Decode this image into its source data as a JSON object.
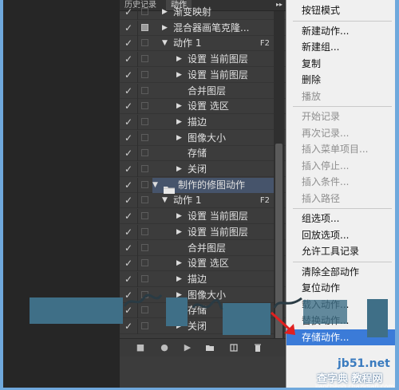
{
  "panel": {
    "tabs": [
      "历史记录",
      "动作"
    ],
    "menu_button_icon": "double-arrow-menu-icon",
    "rows": [
      {
        "check": true,
        "dialog": false,
        "indent": 0,
        "expand": "collapsed",
        "folder": false,
        "label": "渐变映射",
        "fkey": ""
      },
      {
        "check": true,
        "dialog": true,
        "indent": 0,
        "expand": "collapsed",
        "folder": false,
        "label": "混合器画笔克隆...",
        "fkey": ""
      },
      {
        "check": true,
        "dialog": false,
        "indent": 0,
        "expand": "expanded",
        "folder": false,
        "label": "动作 1",
        "fkey": "F2"
      },
      {
        "check": true,
        "dialog": false,
        "indent": 1,
        "expand": "collapsed",
        "folder": false,
        "label": "设置 当前图层",
        "fkey": ""
      },
      {
        "check": true,
        "dialog": false,
        "indent": 1,
        "expand": "collapsed",
        "folder": false,
        "label": "设置 当前图层",
        "fkey": ""
      },
      {
        "check": true,
        "dialog": false,
        "indent": 1,
        "expand": "none",
        "folder": false,
        "label": "合并图层",
        "fkey": ""
      },
      {
        "check": true,
        "dialog": false,
        "indent": 1,
        "expand": "collapsed",
        "folder": false,
        "label": "设置 选区",
        "fkey": ""
      },
      {
        "check": true,
        "dialog": false,
        "indent": 1,
        "expand": "collapsed",
        "folder": false,
        "label": "描边",
        "fkey": ""
      },
      {
        "check": true,
        "dialog": false,
        "indent": 1,
        "expand": "collapsed",
        "folder": false,
        "label": "图像大小",
        "fkey": ""
      },
      {
        "check": true,
        "dialog": false,
        "indent": 1,
        "expand": "none",
        "folder": false,
        "label": "存储",
        "fkey": ""
      },
      {
        "check": true,
        "dialog": false,
        "indent": 1,
        "expand": "collapsed",
        "folder": false,
        "label": "关闭",
        "fkey": ""
      },
      {
        "check": true,
        "dialog": false,
        "indent": -1,
        "expand": "expanded",
        "folder": true,
        "label": "制作的修图动作",
        "fkey": "",
        "selected": true
      },
      {
        "check": true,
        "dialog": false,
        "indent": 0,
        "expand": "expanded",
        "folder": false,
        "label": "动作 1",
        "fkey": "F2"
      },
      {
        "check": true,
        "dialog": false,
        "indent": 1,
        "expand": "collapsed",
        "folder": false,
        "label": "设置 当前图层",
        "fkey": ""
      },
      {
        "check": true,
        "dialog": false,
        "indent": 1,
        "expand": "collapsed",
        "folder": false,
        "label": "设置 当前图层",
        "fkey": ""
      },
      {
        "check": true,
        "dialog": false,
        "indent": 1,
        "expand": "none",
        "folder": false,
        "label": "合并图层",
        "fkey": ""
      },
      {
        "check": true,
        "dialog": false,
        "indent": 1,
        "expand": "collapsed",
        "folder": false,
        "label": "设置 选区",
        "fkey": ""
      },
      {
        "check": true,
        "dialog": false,
        "indent": 1,
        "expand": "collapsed",
        "folder": false,
        "label": "描边",
        "fkey": ""
      },
      {
        "check": true,
        "dialog": false,
        "indent": 1,
        "expand": "collapsed",
        "folder": false,
        "label": "图像大小",
        "fkey": ""
      },
      {
        "check": true,
        "dialog": false,
        "indent": 1,
        "expand": "none",
        "folder": false,
        "label": "存储",
        "fkey": ""
      },
      {
        "check": true,
        "dialog": false,
        "indent": 1,
        "expand": "collapsed",
        "folder": false,
        "label": "关闭",
        "fkey": ""
      }
    ],
    "bottom_icons": [
      "stop-icon",
      "record-icon",
      "play-icon",
      "new-set-folder-icon",
      "new-action-icon",
      "delete-trash-icon"
    ]
  },
  "menu": {
    "items": [
      {
        "label": "按钮模式",
        "disabled": false
      },
      {
        "sep": true
      },
      {
        "label": "新建动作...",
        "disabled": false
      },
      {
        "label": "新建组...",
        "disabled": false
      },
      {
        "label": "复制",
        "disabled": false
      },
      {
        "label": "删除",
        "disabled": false
      },
      {
        "label": "播放",
        "disabled": true
      },
      {
        "sep": true
      },
      {
        "label": "开始记录",
        "disabled": true
      },
      {
        "label": "再次记录...",
        "disabled": true
      },
      {
        "label": "插入菜单项目...",
        "disabled": true
      },
      {
        "label": "插入停止...",
        "disabled": true
      },
      {
        "label": "插入条件...",
        "disabled": true
      },
      {
        "label": "插入路径",
        "disabled": true
      },
      {
        "sep": true
      },
      {
        "label": "组选项...",
        "disabled": false
      },
      {
        "label": "回放选项...",
        "disabled": false
      },
      {
        "label": "允许工具记录",
        "disabled": false
      },
      {
        "sep": true
      },
      {
        "label": "清除全部动作",
        "disabled": false
      },
      {
        "label": "复位动作",
        "disabled": false
      },
      {
        "label": "载入动作...",
        "disabled": false
      },
      {
        "label": "替换动作...",
        "disabled": false
      },
      {
        "label": "存储动作...",
        "disabled": false,
        "highlight": true
      }
    ]
  },
  "overlays": {
    "logo_site": "jb51.net",
    "logo_cn": "查字典 教程网",
    "logo_url": "jiaocheng.chazidian.com",
    "arrow_color": "#e02020"
  }
}
